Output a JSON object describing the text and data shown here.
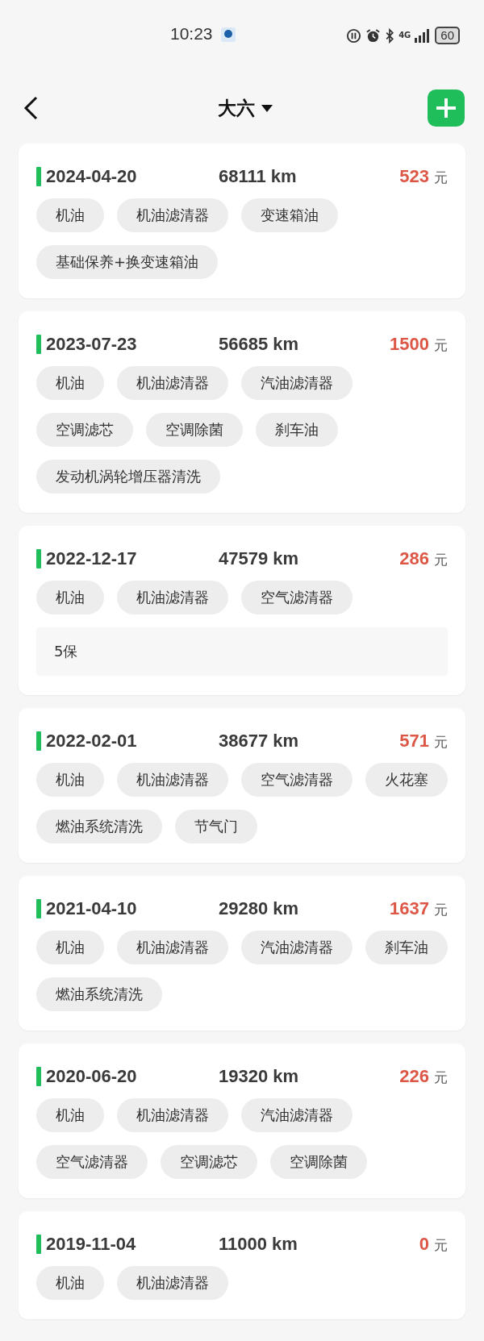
{
  "status_bar": {
    "time": "10:23",
    "network": "4G",
    "battery": "60"
  },
  "header": {
    "title": "大六"
  },
  "records": [
    {
      "date": "2024-04-20",
      "mileage": "68111 km",
      "cost": "523",
      "currency": "元",
      "items": [
        "机油",
        "机油滤清器",
        "变速箱油",
        "基础保养+换变速箱油"
      ]
    },
    {
      "date": "2023-07-23",
      "mileage": "56685 km",
      "cost": "1500",
      "currency": "元",
      "items": [
        "机油",
        "机油滤清器",
        "汽油滤清器",
        "空调滤芯",
        "空调除菌",
        "刹车油",
        "发动机涡轮增压器清洗"
      ]
    },
    {
      "date": "2022-12-17",
      "mileage": "47579 km",
      "cost": "286",
      "currency": "元",
      "items": [
        "机油",
        "机油滤清器",
        "空气滤清器"
      ],
      "note": "5保"
    },
    {
      "date": "2022-02-01",
      "mileage": "38677 km",
      "cost": "571",
      "currency": "元",
      "items": [
        "机油",
        "机油滤清器",
        "空气滤清器",
        "火花塞",
        "燃油系统清洗",
        "节气门"
      ]
    },
    {
      "date": "2021-04-10",
      "mileage": "29280 km",
      "cost": "1637",
      "currency": "元",
      "items": [
        "机油",
        "机油滤清器",
        "汽油滤清器",
        "刹车油",
        "燃油系统清洗"
      ]
    },
    {
      "date": "2020-06-20",
      "mileage": "19320 km",
      "cost": "226",
      "currency": "元",
      "items": [
        "机油",
        "机油滤清器",
        "汽油滤清器",
        "空气滤清器",
        "空调滤芯",
        "空调除菌"
      ]
    },
    {
      "date": "2019-11-04",
      "mileage": "11000 km",
      "cost": "0",
      "currency": "元",
      "items": [
        "机油",
        "机油滤清器"
      ]
    }
  ]
}
